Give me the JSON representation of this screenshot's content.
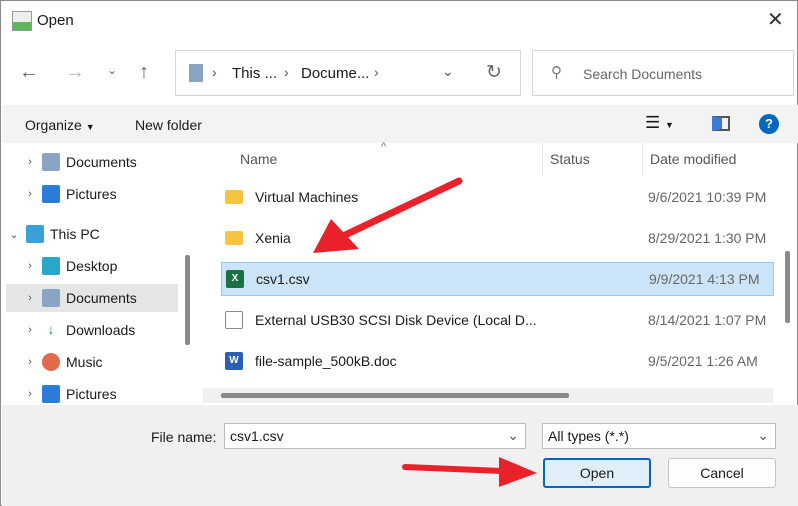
{
  "window": {
    "title": "Open"
  },
  "address": {
    "crumbs": [
      "This ...",
      "Docume..."
    ]
  },
  "search": {
    "placeholder": "Search Documents"
  },
  "toolbar": {
    "organize": "Organize",
    "new_folder": "New folder",
    "help": "?"
  },
  "sidebar": {
    "items": [
      {
        "label": "Documents",
        "icon": "documents-icon",
        "indent": 1
      },
      {
        "label": "Pictures",
        "icon": "pictures-icon",
        "indent": 1
      },
      {
        "label": "This PC",
        "icon": "pc-icon",
        "indent": 0,
        "expanded": true
      },
      {
        "label": "Desktop",
        "icon": "desktop-icon",
        "indent": 1
      },
      {
        "label": "Documents",
        "icon": "documents-icon",
        "indent": 1,
        "selected": true
      },
      {
        "label": "Downloads",
        "icon": "downloads-icon",
        "indent": 1
      },
      {
        "label": "Music",
        "icon": "music-icon",
        "indent": 1
      },
      {
        "label": "Pictures",
        "icon": "pictures-icon",
        "indent": 1
      }
    ]
  },
  "columns": {
    "name": "Name",
    "status": "Status",
    "date": "Date modified"
  },
  "files": [
    {
      "name": "Virtual Machines",
      "date": "9/6/2021 10:39 PM",
      "type": "folder"
    },
    {
      "name": "Xenia",
      "date": "8/29/2021 1:30 PM",
      "type": "folder"
    },
    {
      "name": "csv1.csv",
      "date": "9/9/2021 4:13 PM",
      "type": "csv",
      "selected": true
    },
    {
      "name": "External USB30 SCSI Disk Device (Local D...",
      "date": "8/14/2021 1:07 PM",
      "type": "file"
    },
    {
      "name": "file-sample_500kB.doc",
      "date": "9/5/2021 1:26 AM",
      "type": "doc"
    }
  ],
  "footer": {
    "file_name_label": "File name:",
    "file_name_value": "csv1.csv",
    "file_type": "All types (*.*)",
    "open": "Open",
    "cancel": "Cancel"
  },
  "colors": {
    "selection": "#cce4f7",
    "arrow": "#e8212b",
    "accent": "#0067c0"
  }
}
